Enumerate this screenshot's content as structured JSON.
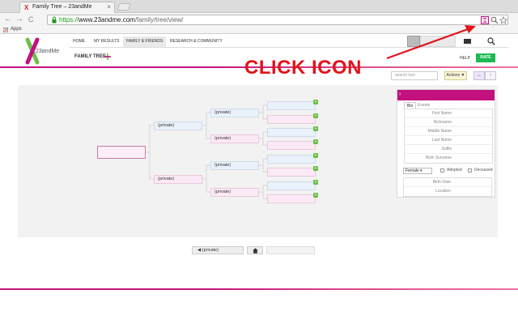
{
  "browser": {
    "tab_title": "Family Tree – 23andMe",
    "tab_close": "×",
    "url_scheme": "https://",
    "url_host": "www.23andme.com",
    "url_path": "/family/tree/view/",
    "bookmarks_apps": "Apps",
    "back": "←",
    "forward": "→",
    "reload": "C"
  },
  "site": {
    "logo_text": "23andMe",
    "nav": [
      "HOME",
      "MY RESULTS",
      "FAMILY & FRIENDS",
      "RESEARCH & COMMUNITY"
    ],
    "subtitle": "FAMILY TREE",
    "help": "HELP",
    "rate": "RATE"
  },
  "annotation": {
    "label": "CLICK ICON",
    "color": "#e2141b"
  },
  "tree_controls": {
    "search_placeholder": "search tree",
    "actions": "Actions ▼",
    "view_a": "↔",
    "view_b": "↕"
  },
  "tree": {
    "private_label": "(private)",
    "plus": "+"
  },
  "panel": {
    "tabs": [
      "Bio",
      "Events"
    ],
    "fields_top": [
      "First Name",
      "Nickname",
      "Middle Name",
      "Last Name",
      "Suffix",
      "Birth Surname"
    ],
    "gender": "Female ▾",
    "adopted": "Adopted",
    "deceased": "Deceased",
    "fields_bottom": [
      "Birth Date",
      "Location"
    ]
  },
  "pager": {
    "prev": "◀ (private)"
  },
  "colors": {
    "brand_magenta": "#c3117f",
    "rate_green": "#1db954",
    "plus_green": "#6cc04a"
  }
}
